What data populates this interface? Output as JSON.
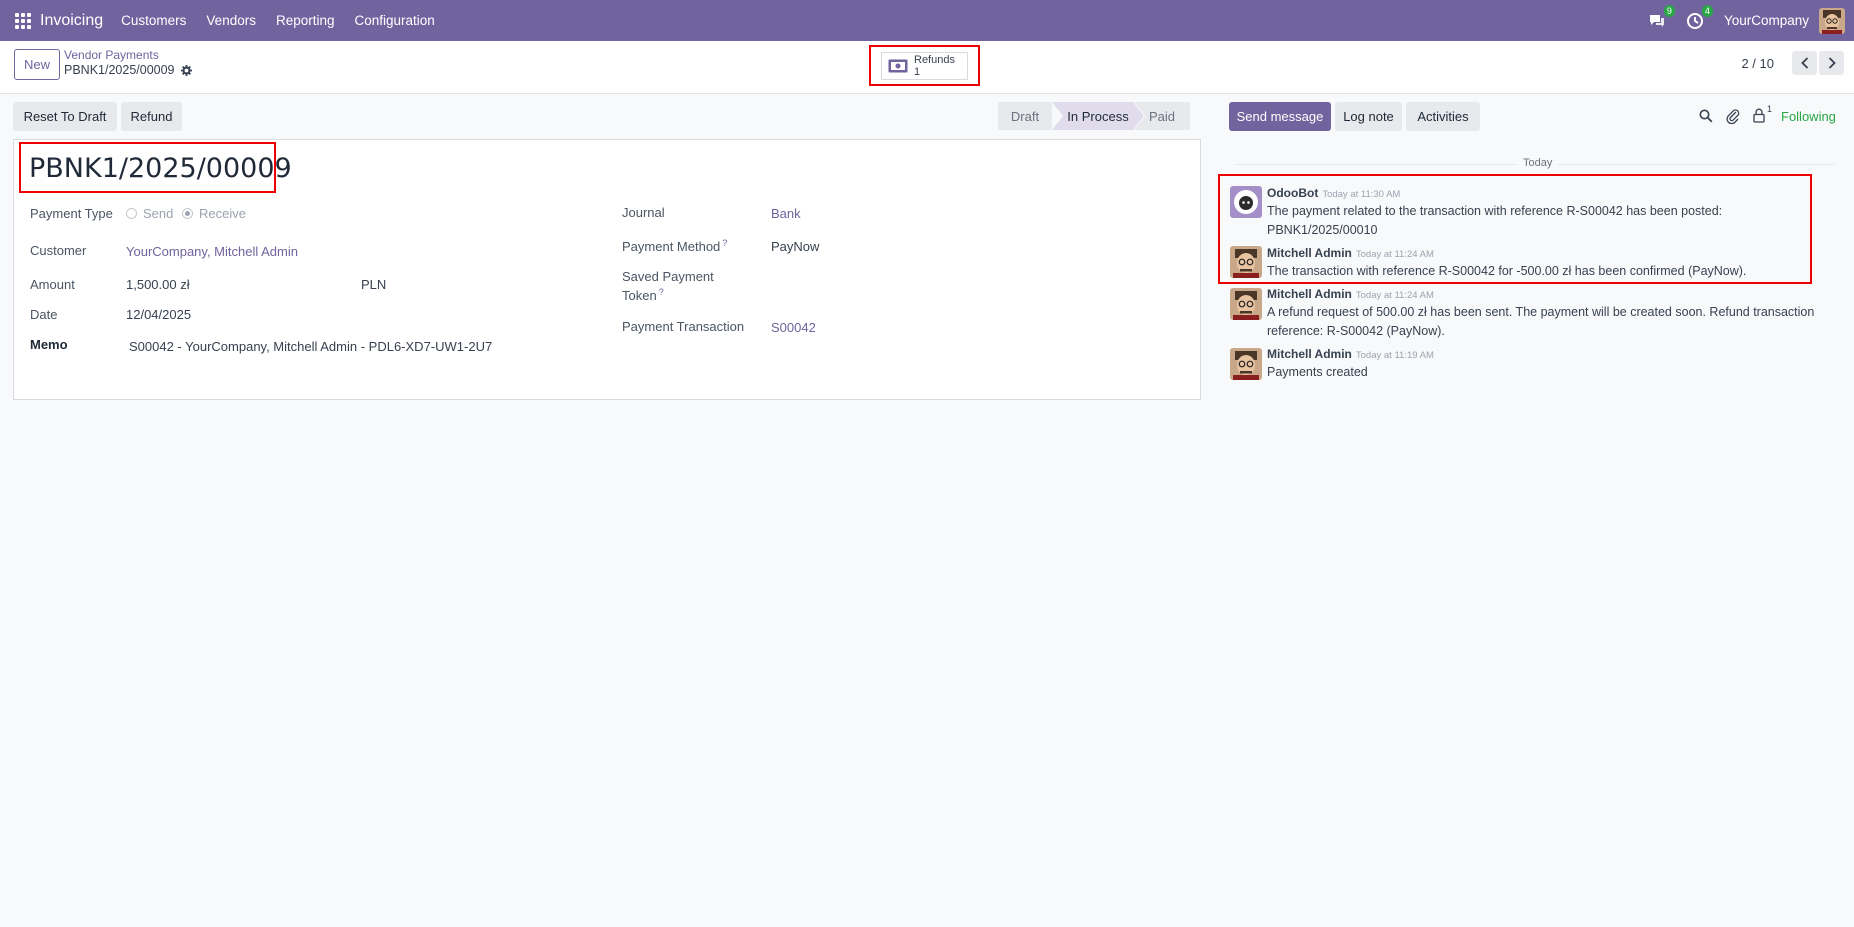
{
  "topbar": {
    "app_name": "Invoicing",
    "menu": [
      "Customers",
      "Vendors",
      "Reporting",
      "Configuration"
    ],
    "messages_badge": "9",
    "activities_badge": "4",
    "company": "YourCompany"
  },
  "control": {
    "new_label": "New",
    "breadcrumb_parent": "Vendor Payments",
    "breadcrumb_current": "PBNK1/2025/00009",
    "smart_button": {
      "label": "Refunds",
      "count": "1"
    },
    "pager": "2 / 10"
  },
  "actions": {
    "reset_to_draft": "Reset To Draft",
    "refund": "Refund"
  },
  "status": {
    "stages": [
      "Draft",
      "In Process",
      "Paid"
    ],
    "active": "In Process"
  },
  "form": {
    "title": "PBNK1/2025/00009",
    "payment_type_label": "Payment Type",
    "payment_type_options": [
      "Send",
      "Receive"
    ],
    "payment_type_selected": "Receive",
    "customer_label": "Customer",
    "customer_value": "YourCompany, Mitchell Admin",
    "amount_label": "Amount",
    "amount_value": "1,500.00 zł",
    "currency": "PLN",
    "date_label": "Date",
    "date_value": "12/04/2025",
    "memo_label": "Memo",
    "memo_value": "S00042 - YourCompany, Mitchell Admin - PDL6-XD7-UW1-2U7",
    "journal_label": "Journal",
    "journal_value": "Bank",
    "payment_method_label": "Payment Method",
    "payment_method_value": "PayNow",
    "saved_token_label_1": "Saved Payment",
    "saved_token_label_2": "Token",
    "transaction_label": "Payment Transaction",
    "transaction_value": "S00042",
    "help_mark": "?"
  },
  "chatter": {
    "send_message": "Send message",
    "log_note": "Log note",
    "activities": "Activities",
    "followers_count": "1",
    "following": "Following",
    "separator": "Today",
    "messages": [
      {
        "author": "OdooBot",
        "time": "Today at 11:30 AM",
        "line1": "The payment related to the transaction with reference R-S00042 has been posted:",
        "line2": "PBNK1/2025/00010"
      },
      {
        "author": "Mitchell Admin",
        "time": "Today at 11:24 AM",
        "line1": "The transaction with reference R-S00042 for -500.00 zł has been confirmed (PayNow)."
      },
      {
        "author": "Mitchell Admin",
        "time": "Today at 11:24 AM",
        "line1": "A refund request of 500.00 zł has been sent. The payment will be created soon. Refund transaction",
        "line2": "reference: R-S00042 (PayNow)."
      },
      {
        "author": "Mitchell Admin",
        "time": "Today at 11:19 AM",
        "line1": "Payments created"
      }
    ]
  },
  "colors": {
    "brand": "#71639e",
    "highlight": "#e00000",
    "badge": "#28a745",
    "following": "#28a745"
  }
}
